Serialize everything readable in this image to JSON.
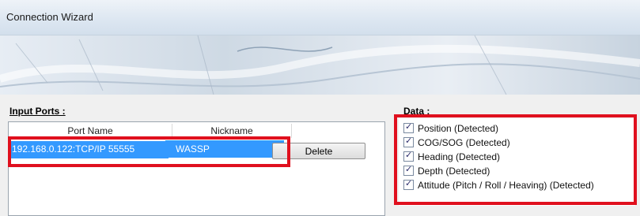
{
  "window": {
    "title": "Connection Wizard"
  },
  "input_ports": {
    "label": "Input Ports :",
    "columns": [
      "Port Name",
      "Nickname"
    ],
    "rows": [
      {
        "port_name": "192.168.0.122:TCP/IP 55555",
        "nickname": "WASSP"
      }
    ],
    "delete_label": "Delete"
  },
  "data": {
    "label": "Data :",
    "items": [
      {
        "label": "Position (Detected)",
        "checked": true
      },
      {
        "label": "COG/SOG (Detected)",
        "checked": true
      },
      {
        "label": "Heading (Detected)",
        "checked": true
      },
      {
        "label": "Depth (Detected)",
        "checked": true
      },
      {
        "label": "Attitude (Pitch / Roll / Heaving) (Detected)",
        "checked": true
      }
    ]
  },
  "colors": {
    "highlight": "#e0101e",
    "selection": "#3399ff"
  }
}
